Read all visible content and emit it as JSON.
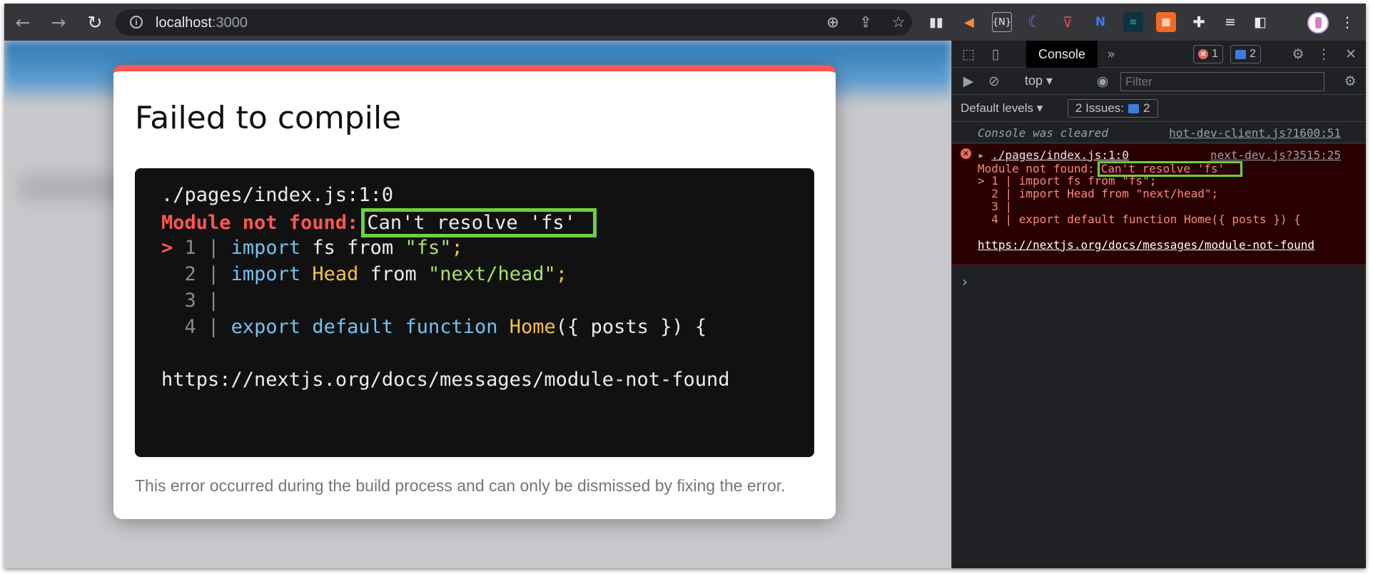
{
  "browser": {
    "url_host": "localhost",
    "url_port": ":3000"
  },
  "dialog": {
    "title": "Failed to compile",
    "file_ref": "./pages/index.js:1:0",
    "error_label": "Module not found:",
    "error_message": "Can't resolve 'fs'",
    "code_lines": [
      {
        "marker": ">",
        "num": "1",
        "parts": [
          "import",
          " fs ",
          "from",
          " \"fs\"",
          ";"
        ]
      },
      {
        "marker": "",
        "num": "2",
        "parts": [
          "import",
          " ",
          "Head",
          " from ",
          "\"next/head\"",
          ";"
        ]
      },
      {
        "marker": "",
        "num": "3",
        "parts": []
      },
      {
        "marker": "",
        "num": "4",
        "parts": [
          "export",
          " ",
          "default",
          " ",
          "function",
          " ",
          "Home",
          "({ posts }) {"
        ]
      }
    ],
    "doc_url": "https://nextjs.org/docs/messages/module-not-found",
    "footer": "This error occurred during the build process and can only be dismissed by fixing the error."
  },
  "devtools": {
    "active_tab": "Console",
    "error_count": "1",
    "message_count": "2",
    "context": "top",
    "filter_placeholder": "Filter",
    "default_levels": "Default levels",
    "issues_label": "2 Issues:",
    "issues_count": "2",
    "cleared_text": "Console was cleared",
    "cleared_source": "hot-dev-client.js?1600:51",
    "error_source": "next-dev.js?3515:25",
    "error_path": "./pages/index.js:1:0",
    "error_label": "Module not found:",
    "error_message": "Can't resolve 'fs'",
    "code_lines": [
      "> 1 | import fs from \"fs\";",
      "  2 | import Head from \"next/head\";",
      "  3 |",
      "  4 | export default function Home({ posts }) {"
    ],
    "doc_url": "https://nextjs.org/docs/messages/module-not-found"
  },
  "icons": [
    "back-arrow-icon",
    "forward-arrow-icon",
    "reload-icon",
    "site-info-icon",
    "zoom-icon",
    "share-icon",
    "bookmark-star-icon",
    "extension-icons",
    "puzzle-icon",
    "media-controls-icon",
    "side-panel-icon",
    "profile-avatar",
    "kebab-menu-icon"
  ],
  "colors": {
    "error_red": "#ff5555",
    "highlight_green": "#6bd23e",
    "keyword_blue": "#6fc4f2",
    "string_green": "#a9e06a",
    "identifier_yellow": "#f4c23f"
  }
}
